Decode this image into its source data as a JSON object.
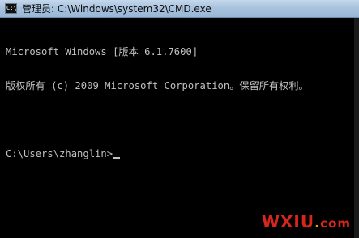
{
  "window": {
    "icon_label": "C:\\",
    "icon_name": "cmd-console-icon",
    "title": "管理员: C:\\Windows\\system32\\CMD.exe"
  },
  "console": {
    "lines": [
      "Microsoft Windows [版本 6.1.7600]",
      "版权所有 (c) 2009 Microsoft Corporation。保留所有权利。",
      "",
      "C:\\Users\\zhanglin>"
    ]
  },
  "watermark": {
    "main": "WXIU",
    "dot": ".",
    "tail": "com"
  },
  "colors": {
    "console_background": "#000000",
    "console_text": "#c0c0c0",
    "titlebar": "#a9c3de",
    "watermark_red": "#d9261c",
    "watermark_orange": "#e8a317"
  }
}
